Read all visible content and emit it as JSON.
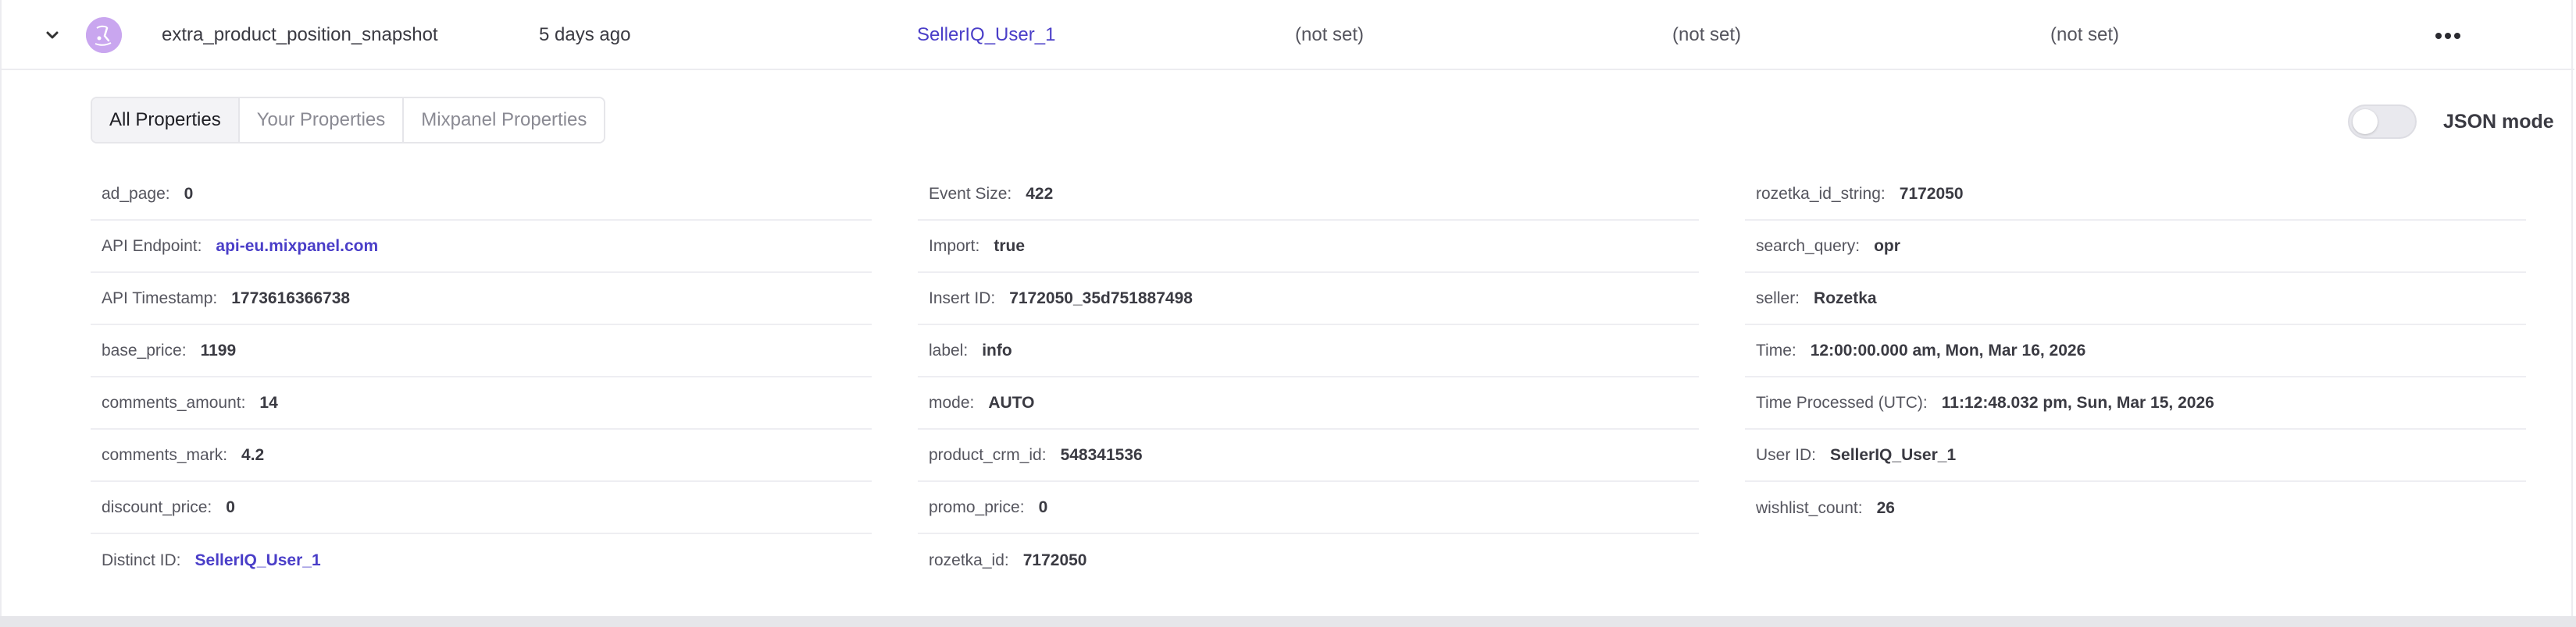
{
  "event": {
    "name": "extra_product_position_snapshot",
    "time_ago": "5 days ago",
    "user": "SellerIQ_User_1",
    "col1": "(not set)",
    "col2": "(not set)",
    "col3": "(not set)"
  },
  "tabs": [
    "All Properties",
    "Your Properties",
    "Mixpanel Properties"
  ],
  "json_mode_label": "JSON mode",
  "json_mode_on": false,
  "colors": {
    "accent_link": "#4a3ec8",
    "avatar": "#c9a6ef"
  },
  "icons": [
    "chevron-down-icon",
    "avatar-icon",
    "more-icon"
  ],
  "properties": {
    "col1": [
      {
        "name": "ad_page:",
        "value": "0"
      },
      {
        "name": "API Endpoint:",
        "value": "api-eu.mixpanel.com",
        "link": true
      },
      {
        "name": "API Timestamp:",
        "value": "1773616366738"
      },
      {
        "name": "base_price:",
        "value": "1199"
      },
      {
        "name": "comments_amount:",
        "value": "14"
      },
      {
        "name": "comments_mark:",
        "value": "4.2"
      },
      {
        "name": "discount_price:",
        "value": "0"
      },
      {
        "name": "Distinct ID:",
        "value": "SellerIQ_User_1",
        "link": true
      }
    ],
    "col2": [
      {
        "name": "Event Size:",
        "value": "422"
      },
      {
        "name": "Import:",
        "value": "true"
      },
      {
        "name": "Insert ID:",
        "value": "7172050_35d751887498"
      },
      {
        "name": "label:",
        "value": "info"
      },
      {
        "name": "mode:",
        "value": "AUTO"
      },
      {
        "name": "product_crm_id:",
        "value": "548341536"
      },
      {
        "name": "promo_price:",
        "value": "0"
      },
      {
        "name": "rozetka_id:",
        "value": "7172050"
      }
    ],
    "col3": [
      {
        "name": "rozetka_id_string:",
        "value": "7172050"
      },
      {
        "name": "search_query:",
        "value": "opr"
      },
      {
        "name": "seller:",
        "value": "Rozetka"
      },
      {
        "name": "Time:",
        "value": "12:00:00.000 am, Mon, Mar 16, 2026"
      },
      {
        "name": "Time Processed (UTC):",
        "value": "11:12:48.032 pm, Sun, Mar 15, 2026"
      },
      {
        "name": "User ID:",
        "value": "SellerIQ_User_1"
      },
      {
        "name": "wishlist_count:",
        "value": "26"
      }
    ]
  }
}
